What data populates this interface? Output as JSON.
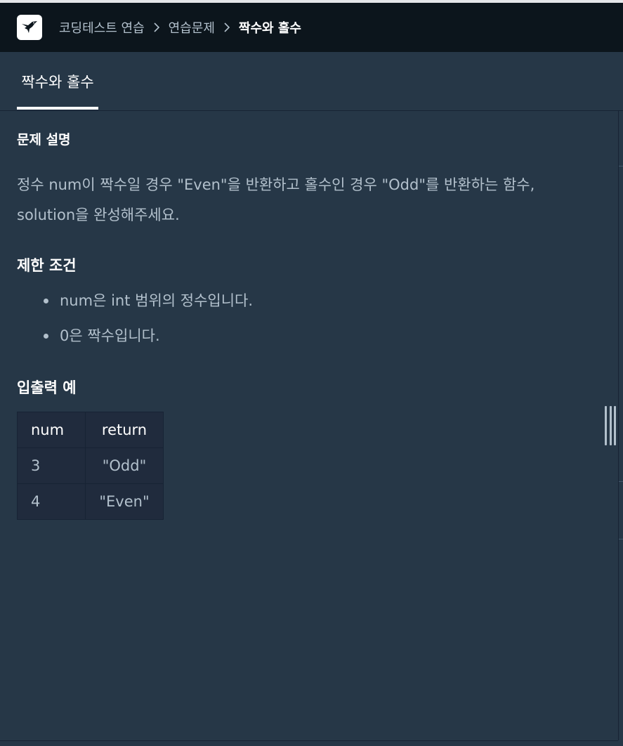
{
  "topbar": {
    "logo_icon": "hummingbird-logo-icon",
    "breadcrumb": [
      {
        "label": "코딩테스트 연습"
      },
      {
        "label": "연습문제"
      },
      {
        "label": "짝수와 홀수"
      }
    ]
  },
  "tabs": [
    {
      "label": "짝수와 홀수",
      "active": true
    }
  ],
  "problem": {
    "description_heading": "문제 설명",
    "description": "정수 num이 짝수일 경우 \"Even\"을 반환하고 홀수인 경우 \"Odd\"를 반환하는 함수, solution을 완성해주세요.",
    "constraints_heading": "제한 조건",
    "constraints": [
      "num은 int 범위의 정수입니다.",
      "0은 짝수입니다."
    ],
    "examples_heading": "입출력 예",
    "examples_table": {
      "headers": [
        "num",
        "return"
      ],
      "rows": [
        [
          "3",
          "\"Odd\""
        ],
        [
          "4",
          "\"Even\""
        ]
      ]
    }
  },
  "colors": {
    "topbar_bg": "#0c151c",
    "page_bg": "#263747",
    "table_bg": "#202b3d",
    "muted_text": "#b2c0cc",
    "text": "#ffffff"
  }
}
